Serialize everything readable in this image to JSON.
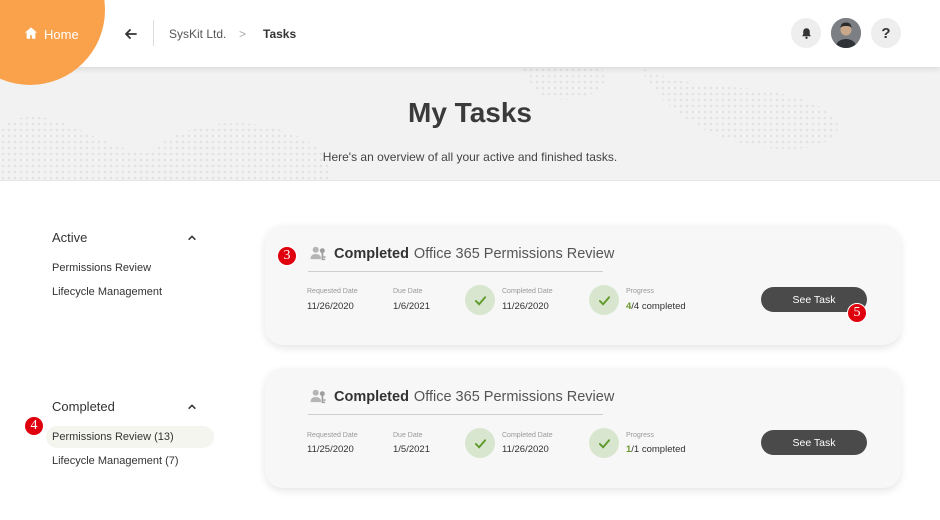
{
  "topbar": {
    "home_label": "Home",
    "breadcrumb_org": "SysKit Ltd.",
    "breadcrumb_sep": ">",
    "breadcrumb_current": "Tasks",
    "help_label": "?"
  },
  "hero": {
    "title": "My Tasks",
    "subtitle": "Here's an overview of all your active and finished tasks."
  },
  "sidebar": {
    "active": {
      "title": "Active",
      "items": [
        "Permissions Review",
        "Lifecycle Management"
      ]
    },
    "completed": {
      "title": "Completed",
      "items": [
        "Permissions Review (13)",
        "Lifecycle Management (7)"
      ]
    }
  },
  "tasks": [
    {
      "status": "Completed",
      "name": "Office 365 Permissions Review",
      "requested_label": "Requested Date",
      "requested": "11/26/2020",
      "due_label": "Due Date",
      "due": "1/6/2021",
      "completed_label": "Completed Date",
      "completed": "11/26/2020",
      "progress_label": "Progress",
      "progress_done": "4",
      "progress_total": "/4 completed",
      "button": "See Task"
    },
    {
      "status": "Completed",
      "name": "Office 365 Permissions Review",
      "requested_label": "Requested Date",
      "requested": "11/25/2020",
      "due_label": "Due Date",
      "due": "1/5/2021",
      "completed_label": "Completed Date",
      "completed": "11/26/2020",
      "progress_label": "Progress",
      "progress_done": "1",
      "progress_total": "/1 completed",
      "button": "See Task"
    }
  ],
  "markers": [
    "3",
    "4",
    "5"
  ],
  "colors": {
    "accent": "#f9a24b",
    "button": "#4a4a4a",
    "check_bg": "#d9e6cf",
    "check": "#5e9a2a",
    "marker": "#e0000d"
  },
  "icons": [
    "home-icon",
    "back-arrow-icon",
    "bell-icon",
    "avatar",
    "help-icon",
    "chevron-up-icon",
    "users-key-icon",
    "check-icon"
  ]
}
